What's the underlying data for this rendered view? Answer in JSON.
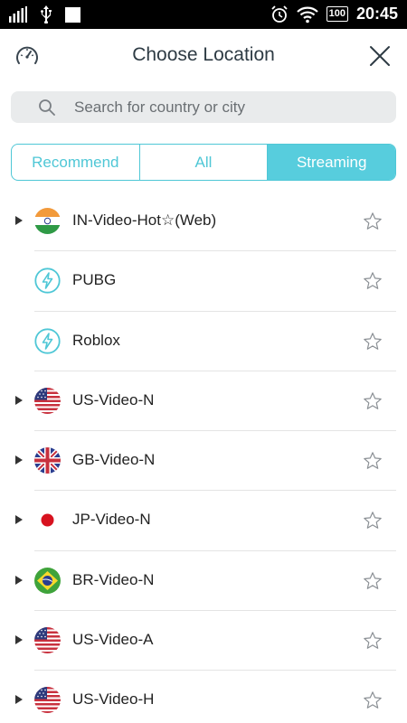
{
  "status_bar": {
    "time": "20:45",
    "battery": "100"
  },
  "header": {
    "title": "Choose Location"
  },
  "search": {
    "placeholder": "Search for country or city"
  },
  "tabs": [
    {
      "label": "Recommend",
      "active": false
    },
    {
      "label": "All",
      "active": false
    },
    {
      "label": "Streaming",
      "active": true
    }
  ],
  "locations": [
    {
      "label": "IN-Video-Hot☆(Web)",
      "icon": "india-flag-icon",
      "expandable": true
    },
    {
      "label": "PUBG",
      "icon": "lightning-icon",
      "expandable": false
    },
    {
      "label": "Roblox",
      "icon": "lightning-icon",
      "expandable": false
    },
    {
      "label": "US-Video-N",
      "icon": "us-flag-icon",
      "expandable": true
    },
    {
      "label": "GB-Video-N",
      "icon": "gb-flag-icon",
      "expandable": true
    },
    {
      "label": "JP-Video-N",
      "icon": "jp-flag-icon",
      "expandable": true
    },
    {
      "label": "BR-Video-N",
      "icon": "br-flag-icon",
      "expandable": true
    },
    {
      "label": "US-Video-A",
      "icon": "us-flag-icon",
      "expandable": true
    },
    {
      "label": "US-Video-H",
      "icon": "us-flag-icon",
      "expandable": true
    }
  ],
  "colors": {
    "accent": "#57cddd",
    "title": "#2e3b44",
    "search_bg": "#e9ebec"
  }
}
